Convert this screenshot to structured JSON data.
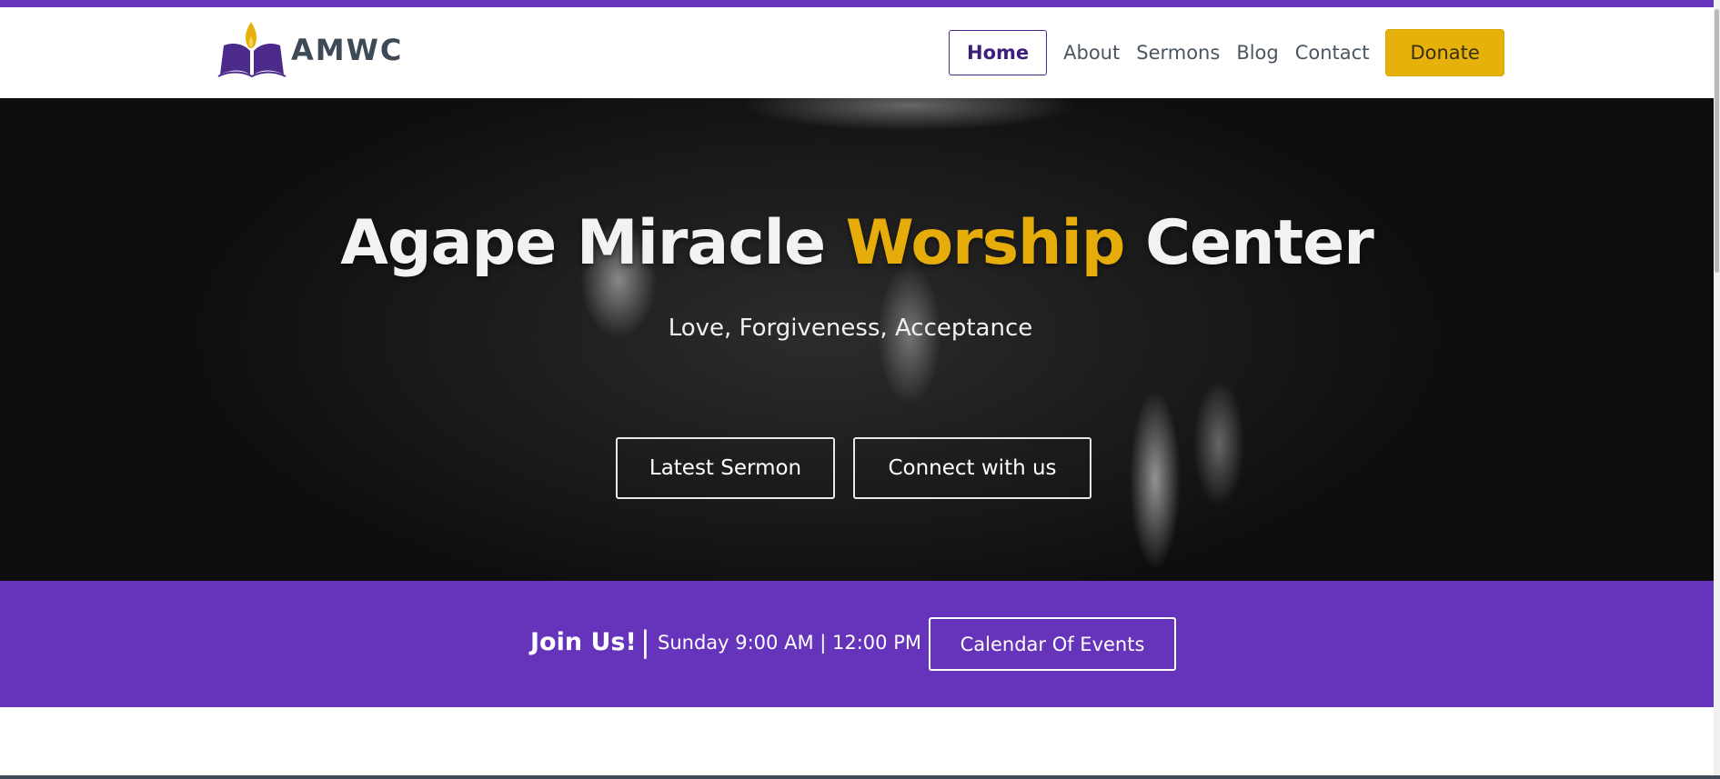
{
  "header": {
    "logo_text": "AMWC",
    "logo_icon": "open-book-flame-icon",
    "nav": {
      "home": "Home",
      "about": "About",
      "sermons": "Sermons",
      "blog": "Blog",
      "contact": "Contact",
      "donate": "Donate"
    }
  },
  "hero": {
    "title_part1": "Agape Miracle",
    "title_accent": "Worship",
    "title_part2": "Center",
    "subtitle": "Love, Forgiveness, Acceptance",
    "btn_sermon": "Latest Sermon",
    "btn_connect": "Connect with us"
  },
  "join": {
    "label": "Join Us!",
    "separator": "|",
    "times": "Sunday 9:00 AM | 12:00 PM",
    "calendar_btn": "Calendar Of Events"
  },
  "colors": {
    "brand_purple": "#6633bb",
    "accent_gold": "#e6ac0a",
    "text_dark": "#3e4a57"
  }
}
